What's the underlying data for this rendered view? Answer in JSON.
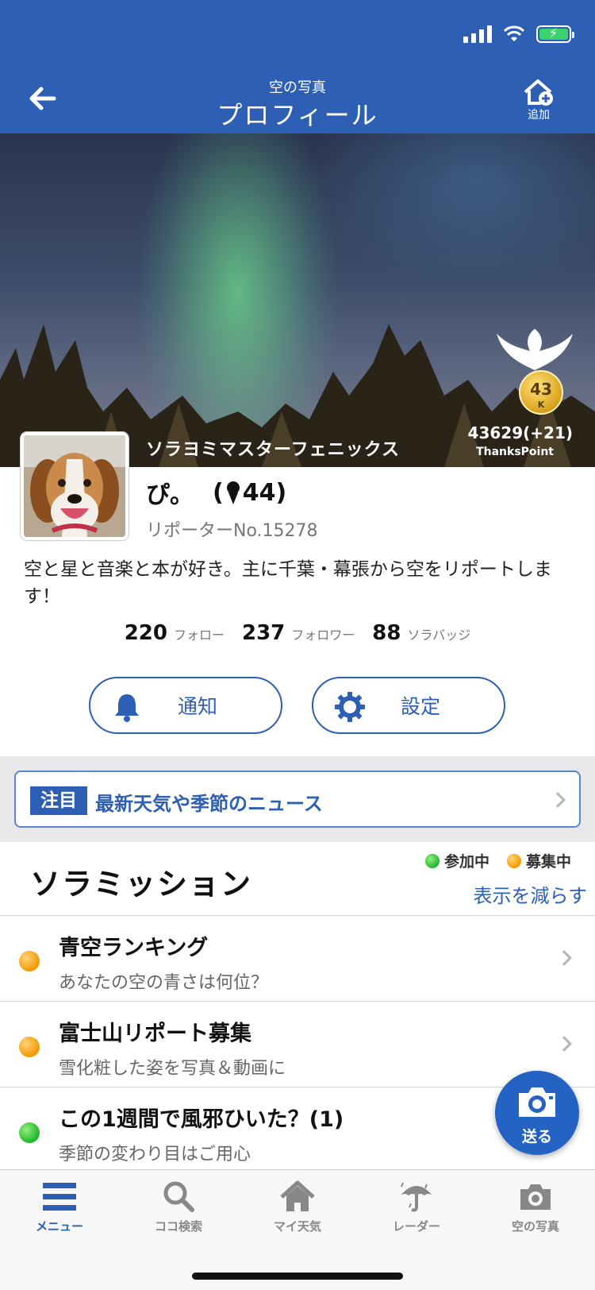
{
  "header": {
    "subtitle": "空の写真",
    "title": "プロフィール",
    "add_label": "追加"
  },
  "hero": {
    "user_title": "ソラヨミマスターフェニックス",
    "rank_badge": "43",
    "rank_badge_unit": "K",
    "thanks_points": "43629(+21)",
    "thanks_label": "ThanksPoint"
  },
  "profile": {
    "username": "ぴ。",
    "pin_count": "(",
    "pin_count_value": "44)",
    "reporter_no": "リポーターNo.15278",
    "bio": "空と星と音楽と本が好き。主に千葉・幕張から空をリポートします！",
    "stats": [
      {
        "value": "220",
        "label": "フォロー"
      },
      {
        "value": "237",
        "label": "フォロワー"
      },
      {
        "value": "88",
        "label": "ソラバッジ"
      }
    ]
  },
  "buttons": {
    "notify_label": "通知",
    "settings_label": "設定"
  },
  "news": {
    "tag": "注目",
    "text": "最新天気や季節のニュース"
  },
  "mission": {
    "title": "ソラミッション",
    "legend_active": "参加中",
    "legend_recruiting": "募集中",
    "show_less": "表示を減らす",
    "items": [
      {
        "title": "青空ランキング",
        "subtitle": "あなたの空の青さは何位？",
        "status": "recruiting"
      },
      {
        "title": "富士山リポート募集",
        "subtitle": "雪化粧した姿を写真＆動画に",
        "status": "recruiting"
      },
      {
        "title": "この1週間で風邪ひいた？(1)",
        "subtitle": "季節の変わり目はご用心",
        "status": "active"
      }
    ]
  },
  "fab": {
    "label": "送る"
  },
  "bottom_nav": [
    {
      "label": "メニュー",
      "icon": "menu-icon",
      "active": true
    },
    {
      "label": "ココ検索",
      "icon": "search-icon",
      "active": false
    },
    {
      "label": "マイ天気",
      "icon": "home-icon",
      "active": false
    },
    {
      "label": "レーダー",
      "icon": "umbrella-icon",
      "active": false
    },
    {
      "label": "空の写真",
      "icon": "camera-icon",
      "active": false
    }
  ],
  "colors": {
    "brand": "#2d5fb5",
    "active_dot": "#21b52a",
    "recruiting_dot": "#f29a00"
  }
}
